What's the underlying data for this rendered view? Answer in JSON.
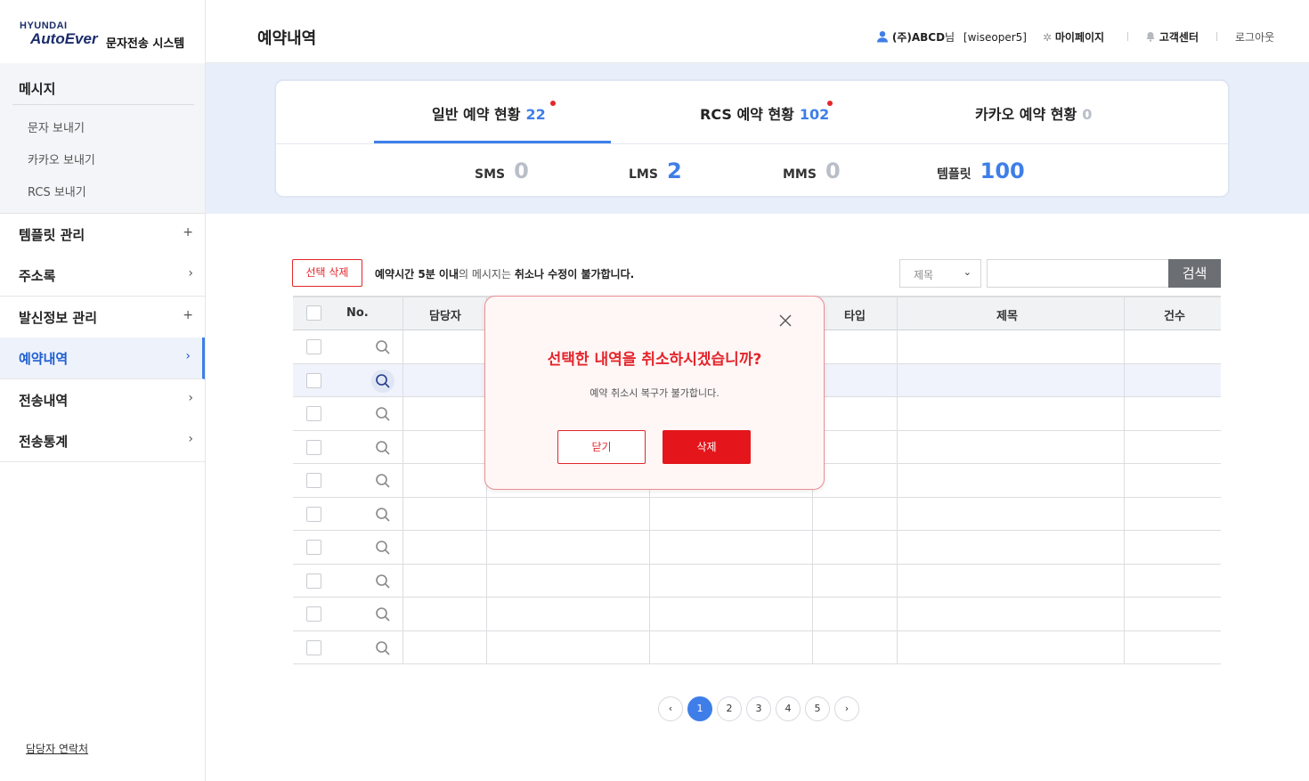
{
  "sidebar": {
    "logo_brand": "HYUNDAI",
    "logo_sub": "AutoEver",
    "system_name": "문자전송 시스템",
    "message_group": {
      "title": "메시지",
      "items": [
        "문자 보내기",
        "카카오 보내기",
        "RCS 보내기"
      ]
    },
    "nav": [
      {
        "label": "템플릿 관리",
        "mark": "+"
      },
      {
        "label": "주소록",
        "mark": "›"
      },
      {
        "label": "발신정보 관리",
        "mark": "+"
      },
      {
        "label": "예약내역",
        "mark": "›"
      },
      {
        "label": "전송내역",
        "mark": "›"
      },
      {
        "label": "전송통계",
        "mark": "›"
      }
    ],
    "contact": "담당자 연락처"
  },
  "header": {
    "title": "예약내역",
    "user_company": "(주)ABCD",
    "user_suffix": "님",
    "user_id": "[wiseoper5]",
    "mypage": "마이페이지",
    "support": "고객센터",
    "logout": "로그아웃"
  },
  "status": {
    "tabs": [
      {
        "label": "일반 예약 현황",
        "count": "22"
      },
      {
        "label": "RCS 예약 현황",
        "count": "102"
      },
      {
        "label": "카카오 예약 현황",
        "count": "0"
      }
    ],
    "stats": [
      {
        "label": "SMS",
        "value": "0"
      },
      {
        "label": "LMS",
        "value": "2"
      },
      {
        "label": "MMS",
        "value": "0"
      },
      {
        "label": "템플릿",
        "value": "100"
      }
    ]
  },
  "toolbar": {
    "delete_selected": "선택 삭제",
    "notice_bold1": "예약시간 5분 이내",
    "notice_mid": "의 메시지는 ",
    "notice_bold2": "취소나 수정이 불가합니다.",
    "select_value": "제목",
    "search_value": "",
    "search_button": "검색"
  },
  "table": {
    "headers": [
      "No.",
      "담당자",
      "",
      "",
      "타입",
      "제목",
      "건수"
    ],
    "row_count": 10
  },
  "pagination": {
    "prev": "‹",
    "pages": [
      "1",
      "2",
      "3",
      "4",
      "5"
    ],
    "next": "›",
    "current": "1"
  },
  "modal": {
    "title": "선택한 내역을 취소하시겠습니까?",
    "message": "예약 취소시 복구가 불가합니다.",
    "close_label": "닫기",
    "delete_label": "삭제"
  },
  "colors": {
    "accent": "#3f7ee8",
    "danger": "#e4262b",
    "band": "#e9effa"
  }
}
